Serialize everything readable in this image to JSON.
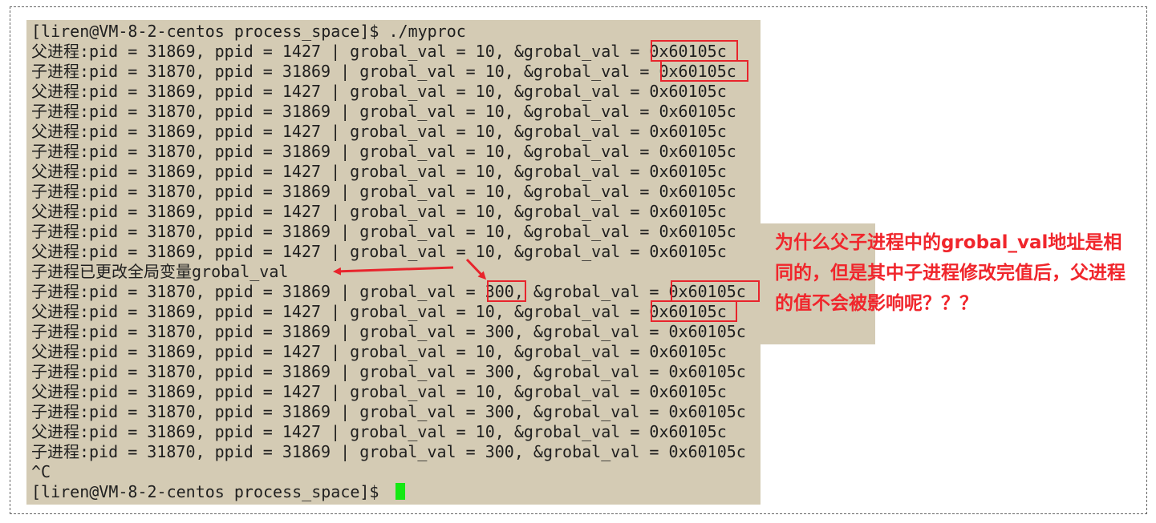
{
  "terminal": {
    "lines": [
      "[liren@VM-8-2-centos process_space]$ ./myproc",
      "父进程:pid = 31869, ppid = 1427 | grobal_val = 10, &grobal_val = 0x60105c",
      "子进程:pid = 31870, ppid = 31869 | grobal_val = 10, &grobal_val = 0x60105c",
      "父进程:pid = 31869, ppid = 1427 | grobal_val = 10, &grobal_val = 0x60105c",
      "子进程:pid = 31870, ppid = 31869 | grobal_val = 10, &grobal_val = 0x60105c",
      "父进程:pid = 31869, ppid = 1427 | grobal_val = 10, &grobal_val = 0x60105c",
      "子进程:pid = 31870, ppid = 31869 | grobal_val = 10, &grobal_val = 0x60105c",
      "父进程:pid = 31869, ppid = 1427 | grobal_val = 10, &grobal_val = 0x60105c",
      "子进程:pid = 31870, ppid = 31869 | grobal_val = 10, &grobal_val = 0x60105c",
      "父进程:pid = 31869, ppid = 1427 | grobal_val = 10, &grobal_val = 0x60105c",
      "子进程:pid = 31870, ppid = 31869 | grobal_val = 10, &grobal_val = 0x60105c",
      "父进程:pid = 31869, ppid = 1427 | grobal_val = 10, &grobal_val = 0x60105c",
      "子进程已更改全局变量grobal_val",
      "子进程:pid = 31870, ppid = 31869 | grobal_val = 300, &grobal_val = 0x60105c",
      "父进程:pid = 31869, ppid = 1427 | grobal_val = 10, &grobal_val = 0x60105c",
      "子进程:pid = 31870, ppid = 31869 | grobal_val = 300, &grobal_val = 0x60105c",
      "父进程:pid = 31869, ppid = 1427 | grobal_val = 10, &grobal_val = 0x60105c",
      "子进程:pid = 31870, ppid = 31869 | grobal_val = 300, &grobal_val = 0x60105c",
      "父进程:pid = 31869, ppid = 1427 | grobal_val = 10, &grobal_val = 0x60105c",
      "子进程:pid = 31870, ppid = 31869 | grobal_val = 300, &grobal_val = 0x60105c",
      "父进程:pid = 31869, ppid = 1427 | grobal_val = 10, &grobal_val = 0x60105c",
      "子进程:pid = 31870, ppid = 31869 | grobal_val = 300, &grobal_val = 0x60105c",
      "^C",
      "[liren@VM-8-2-centos process_space]$ "
    ],
    "cursor_color": "#14e814",
    "background_color": "#d4cbb4",
    "text_color": "#1f1f1f"
  },
  "annotation": {
    "question_text": "为什么父子进程中的grobal_val地址是相同的，但是其中子进程修改完值后，父进程的值不会被影响呢？？？",
    "highlight_color": "#e8242c",
    "question_color": "#f0262c"
  }
}
